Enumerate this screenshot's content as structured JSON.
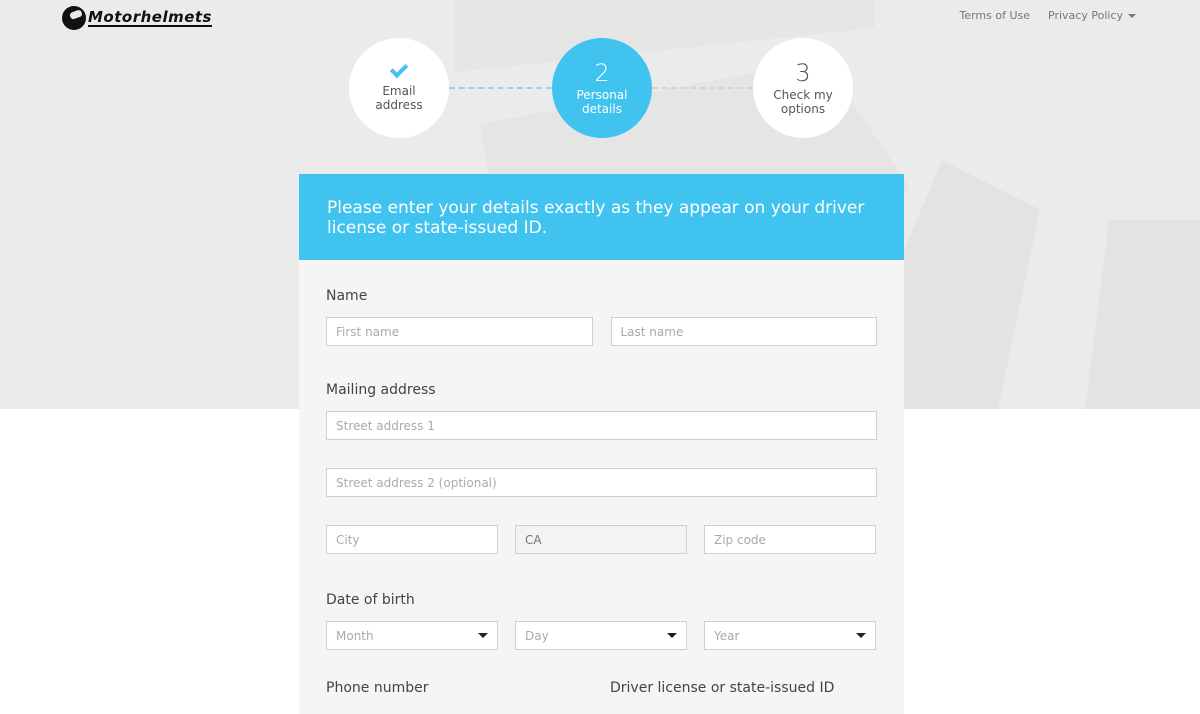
{
  "brand": {
    "name": "Motorhelmets"
  },
  "top_nav": {
    "links": [
      {
        "label": "Terms of Use"
      },
      {
        "label": "Privacy Policy",
        "has_dropdown": true
      }
    ]
  },
  "stepper": {
    "steps": [
      {
        "number": "1",
        "label_line1": "Email",
        "label_line2": "address",
        "state": "completed"
      },
      {
        "number": "2",
        "label_line1": "Personal",
        "label_line2": "details",
        "state": "active"
      },
      {
        "number": "3",
        "label_line1": "Check my",
        "label_line2": "options",
        "state": "upcoming"
      }
    ]
  },
  "form": {
    "header_text": "Please enter your details exactly as they appear on your driver license or state-issued ID.",
    "accent_color": "#41c3f0",
    "name_section": {
      "label": "Name",
      "first_name": {
        "placeholder": "First name",
        "value": ""
      },
      "last_name": {
        "placeholder": "Last name",
        "value": ""
      }
    },
    "address_section": {
      "label": "Mailing address",
      "street1": {
        "placeholder": "Street address 1",
        "value": ""
      },
      "street2": {
        "placeholder": "Street address 2 (optional)",
        "value": ""
      },
      "city": {
        "placeholder": "City",
        "value": ""
      },
      "state": {
        "value": "CA",
        "disabled": true
      },
      "zip": {
        "placeholder": "Zip code",
        "value": ""
      }
    },
    "dob_section": {
      "label": "Date of birth",
      "month": {
        "placeholder": "Month"
      },
      "day": {
        "placeholder": "Day"
      },
      "year": {
        "placeholder": "Year"
      }
    },
    "partial_labels": {
      "left": "Phone number",
      "right": "Driver license or state-issued ID"
    }
  }
}
